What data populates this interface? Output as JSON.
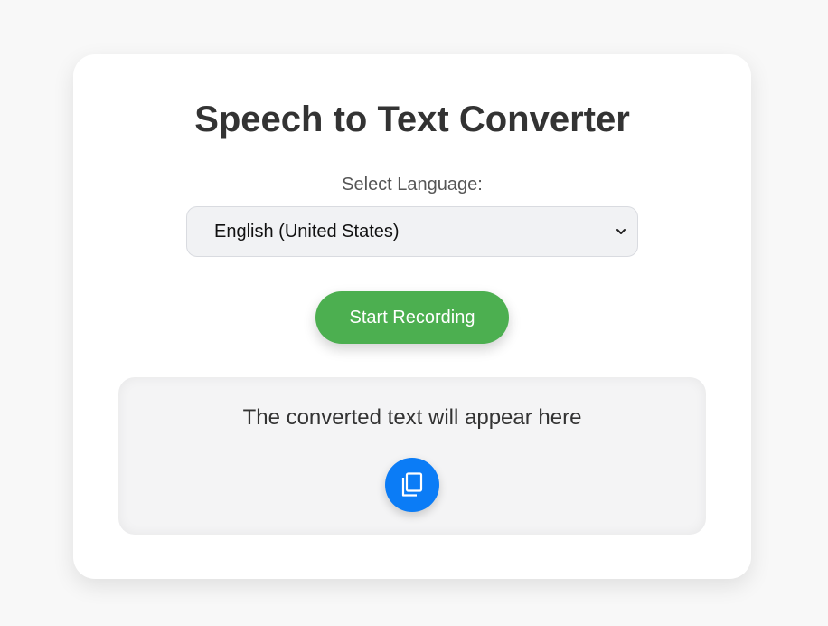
{
  "app": {
    "title": "Speech to Text Converter"
  },
  "language": {
    "label": "Select Language:",
    "selected": "English (United States)"
  },
  "controls": {
    "record_label": "Start Recording",
    "record_color": "#4caf50",
    "copy_icon": "copy-icon",
    "copy_color": "#0b7cf6"
  },
  "output": {
    "placeholder_text": "The converted text will appear here"
  }
}
